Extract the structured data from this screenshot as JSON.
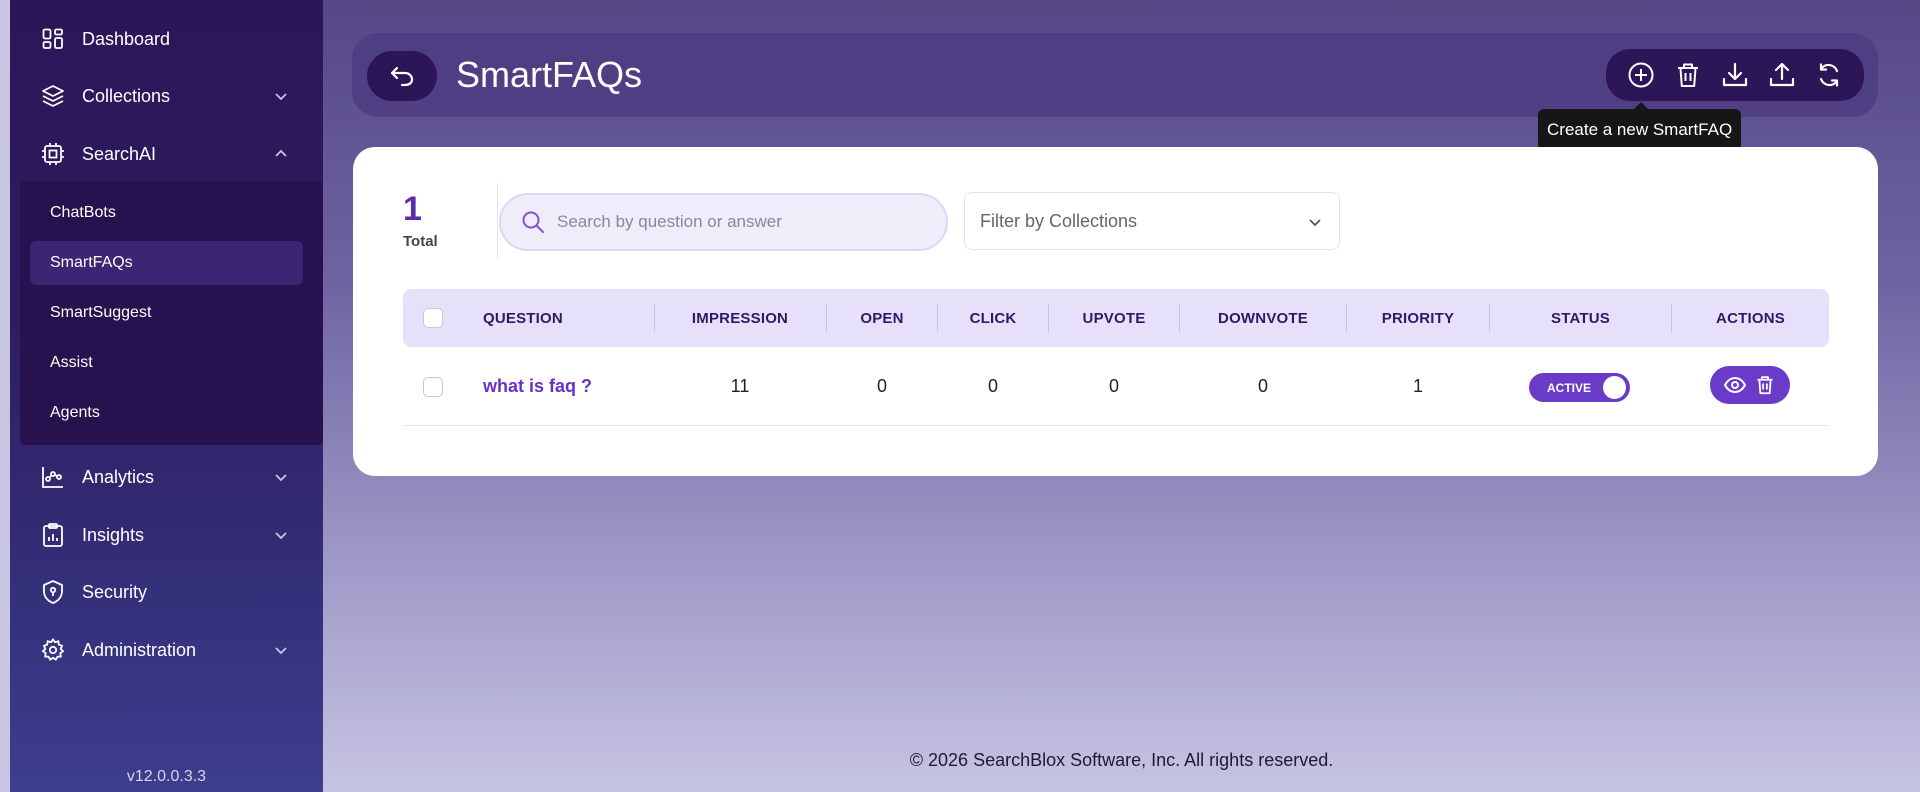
{
  "sidebar": {
    "items": [
      {
        "label": "Dashboard",
        "icon": "dashboard-icon"
      },
      {
        "label": "Collections",
        "icon": "layers-icon"
      },
      {
        "label": "SearchAI",
        "icon": "chip-icon"
      },
      {
        "label": "Analytics",
        "icon": "analytics-icon"
      },
      {
        "label": "Insights",
        "icon": "clipboard-icon"
      },
      {
        "label": "Security",
        "icon": "shield-icon"
      },
      {
        "label": "Administration",
        "icon": "gear-icon"
      }
    ],
    "searchai_sub": [
      "ChatBots",
      "SmartFAQs",
      "SmartSuggest",
      "Assist",
      "Agents"
    ],
    "active_sub": "SmartFAQs",
    "version": "v12.0.0.3.3"
  },
  "header": {
    "title": "SmartFAQs",
    "tools": [
      "add-circle-icon",
      "trash-icon",
      "download-icon",
      "upload-icon",
      "refresh-icon"
    ],
    "tooltip": "Create a new SmartFAQ"
  },
  "summary": {
    "total_count": "1",
    "total_label": "Total"
  },
  "search": {
    "placeholder": "Search by question or answer",
    "value": ""
  },
  "filter": {
    "placeholder": "Filter by Collections"
  },
  "table": {
    "columns": [
      "QUESTION",
      "IMPRESSION",
      "OPEN",
      "CLICK",
      "UPVOTE",
      "DOWNVOTE",
      "PRIORITY",
      "STATUS",
      "ACTIONS"
    ],
    "rows": [
      {
        "question": "what is faq ?",
        "impression": "11",
        "open": "0",
        "click": "0",
        "upvote": "0",
        "downvote": "0",
        "priority": "1",
        "status": "ACTIVE"
      }
    ]
  },
  "footer": {
    "copyright": "© 2026 SearchBlox Software, Inc. All rights reserved."
  },
  "colors": {
    "accent": "#6a3bc9",
    "sidebar": "#2b1658",
    "table_header": "#e7e0fa",
    "link": "#6a31c8"
  }
}
